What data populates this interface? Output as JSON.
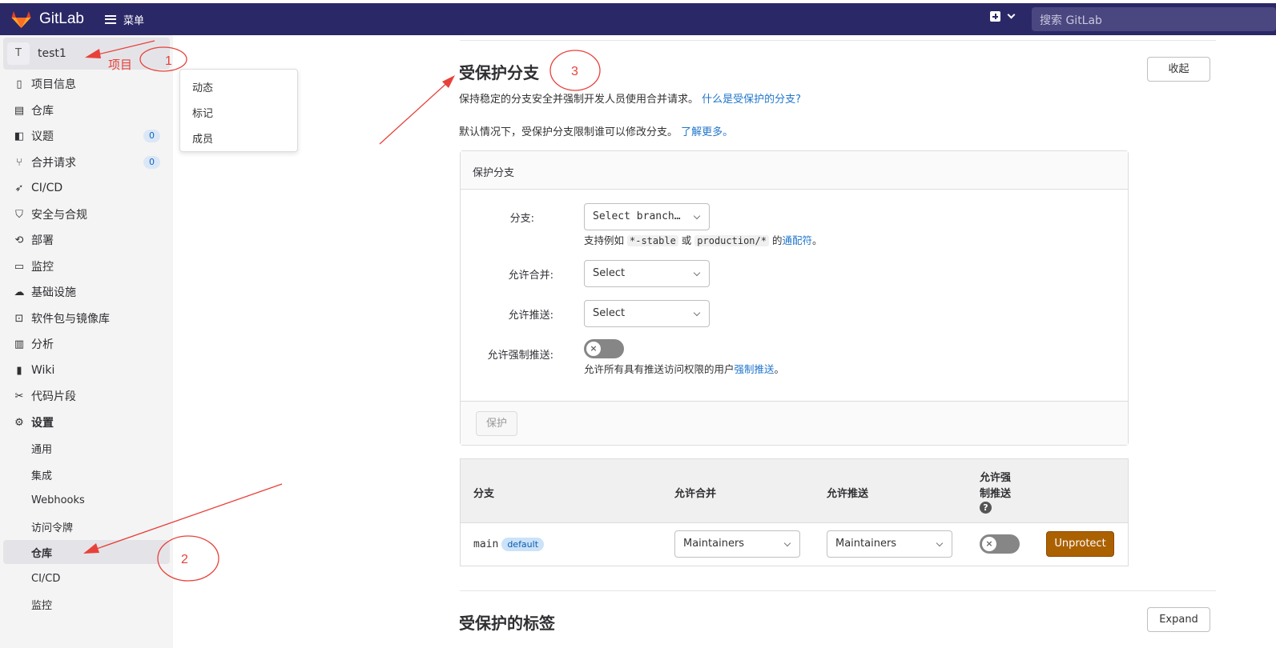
{
  "header": {
    "app_name": "GitLab",
    "menu_label": "菜单",
    "search_placeholder": "搜索 GitLab",
    "bg_color": "#2b2867"
  },
  "sidebar": {
    "project": {
      "avatar_letter": "T",
      "name": "test1"
    },
    "items": [
      {
        "icon": "project-info-icon",
        "label": "项目信息"
      },
      {
        "icon": "repository-icon",
        "label": "仓库"
      },
      {
        "icon": "issues-icon",
        "label": "议题",
        "badge": "0"
      },
      {
        "icon": "merge-request-icon",
        "label": "合并请求",
        "badge": "0"
      },
      {
        "icon": "rocket-icon",
        "label": "CI/CD"
      },
      {
        "icon": "shield-icon",
        "label": "安全与合规"
      },
      {
        "icon": "deployments-icon",
        "label": "部署"
      },
      {
        "icon": "monitor-icon",
        "label": "监控"
      },
      {
        "icon": "cloud-icon",
        "label": "基础设施"
      },
      {
        "icon": "package-icon",
        "label": "软件包与镜像库"
      },
      {
        "icon": "chart-icon",
        "label": "分析"
      },
      {
        "icon": "book-icon",
        "label": "Wiki"
      },
      {
        "icon": "snippet-icon",
        "label": "代码片段"
      },
      {
        "icon": "gear-icon",
        "label": "设置"
      }
    ],
    "settings_sub": [
      "通用",
      "集成",
      "Webhooks",
      "访问令牌",
      "仓库",
      "CI/CD",
      "监控"
    ],
    "active_sub": "仓库"
  },
  "flyout": {
    "items": [
      "动态",
      "标记",
      "成员"
    ]
  },
  "annotations": {
    "label_1": "1",
    "label_2": "2",
    "label_3": "3",
    "project_note": "项目",
    "color": "#e8413a"
  },
  "protected_branches": {
    "title": "受保护分支",
    "collapse_label": "收起",
    "desc": "保持稳定的分支安全并强制开发人员使用合并请求。",
    "desc_link": "什么是受保护的分支?",
    "default_note": "默认情况下，受保护分支限制谁可以修改分支。",
    "learn_more": "了解更多。",
    "form": {
      "header": "保护分支",
      "branch_label": "分支:",
      "branch_placeholder": "Select branch…",
      "branch_help_prefix": "支持例如",
      "branch_help_code1": "*-stable",
      "branch_help_or": "或",
      "branch_help_code2": "production/*",
      "branch_help_of": "的",
      "branch_help_link": "通配符",
      "branch_help_end": "。",
      "merge_label": "允许合并:",
      "merge_value": "Select",
      "push_label": "允许推送:",
      "push_value": "Select",
      "force_label": "允许强制推送:",
      "force_help": "允许所有具有推送访问权限的用户",
      "force_help_link": "强制推送",
      "force_help_end": "。",
      "protect_button": "保护"
    },
    "table": {
      "headers": [
        "分支",
        "允许合并",
        "允许推送",
        "允许强",
        "制推送"
      ],
      "rows": [
        {
          "branch": "main",
          "badge": "default",
          "merge": "Maintainers",
          "push": "Maintainers",
          "force_push": false,
          "action": "Unprotect"
        }
      ],
      "unprotect_color": "#ab6100"
    }
  },
  "protected_tags": {
    "title": "受保护的标签",
    "expand_label": "Expand"
  }
}
